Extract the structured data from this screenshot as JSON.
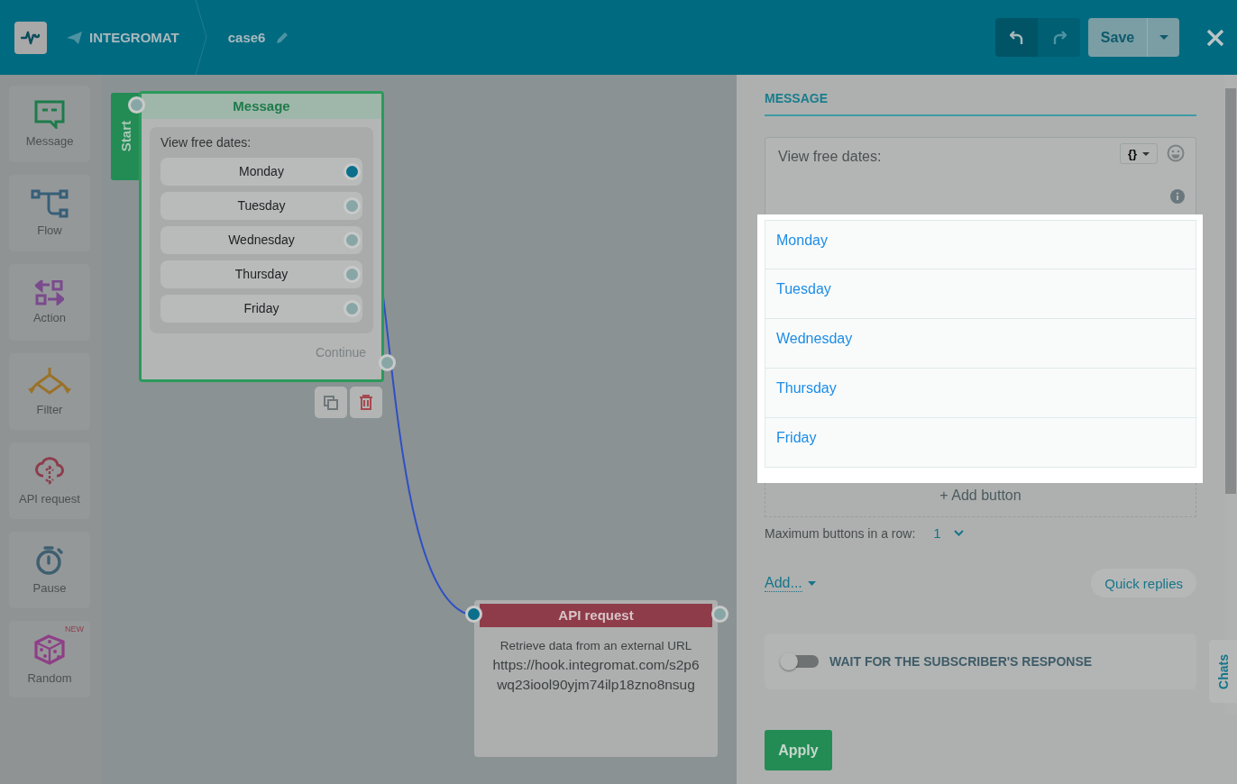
{
  "header": {
    "brand": "INTEGROMAT",
    "scenario": "case6",
    "save": "Save"
  },
  "tools": [
    {
      "label": "Message",
      "kind": "message"
    },
    {
      "label": "Flow",
      "kind": "flow"
    },
    {
      "label": "Action",
      "kind": "action"
    },
    {
      "label": "Filter",
      "kind": "filter"
    },
    {
      "label": "API request",
      "kind": "api"
    },
    {
      "label": "Pause",
      "kind": "pause"
    },
    {
      "label": "Random",
      "kind": "random",
      "badge": "NEW"
    }
  ],
  "message_node": {
    "tab": "Start",
    "title": "Message",
    "text": "View free dates:",
    "continue": "Continue",
    "buttons": [
      {
        "label": "Monday",
        "connected": true
      },
      {
        "label": "Tuesday",
        "connected": false
      },
      {
        "label": "Wednesday",
        "connected": false
      },
      {
        "label": "Thursday",
        "connected": false
      },
      {
        "label": "Friday",
        "connected": false
      }
    ]
  },
  "api_node": {
    "title": "API request",
    "description": "Retrieve data from an external URL",
    "url": "https://hook.integromat.com/s2p6wq23iool90yjm74ilp18zno8nsug"
  },
  "panel": {
    "section": "MESSAGE",
    "message_text": "View free dates:",
    "variables_label": "{}",
    "buttons": [
      "Monday",
      "Tuesday",
      "Wednesday",
      "Thursday",
      "Friday"
    ],
    "add_button": "+ Add button",
    "max_label": "Maximum buttons in a row:",
    "max_value": "1",
    "add_menu": "Add...",
    "quick_replies": "Quick replies",
    "wait_toggle": {
      "label": "WAIT FOR THE SUBSCRIBER'S RESPONSE",
      "on": false
    },
    "apply": "Apply",
    "chats_tab": "Chats"
  }
}
